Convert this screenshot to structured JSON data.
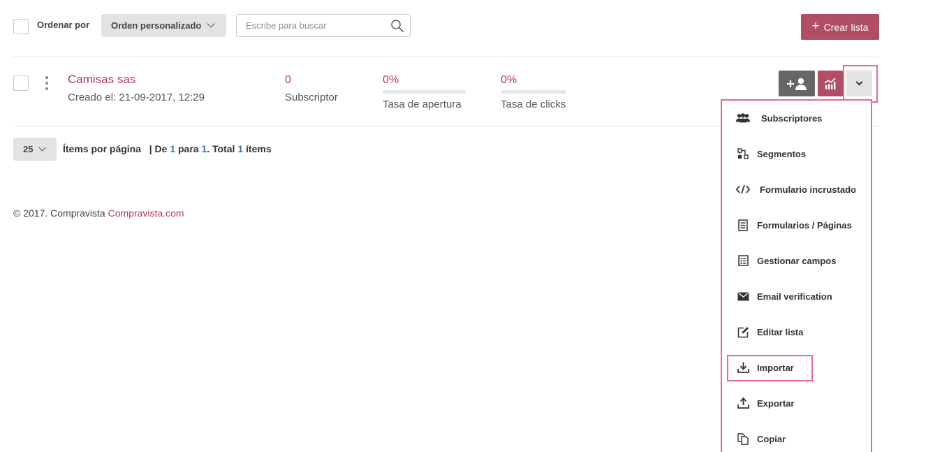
{
  "toolbar": {
    "sort_by_label": "Ordenar por",
    "sort_selected": "Orden personalizado",
    "search_placeholder": "Escribe para buscar",
    "create_label": "Crear lista",
    "create_plus": "+"
  },
  "list_row": {
    "name": "Camisas sas",
    "created": "Creado el: 21-09-2017, 12:29",
    "subscribers": {
      "value": "0",
      "label": "Subscriptor"
    },
    "open_rate": {
      "value": "0%",
      "label": "Tasa de apertura",
      "fraction": 0
    },
    "click_rate": {
      "value": "0%",
      "label": "Tasa de clicks",
      "fraction": 0
    },
    "actions": {
      "add_subscriber_icon": "add-person-icon",
      "stats_icon": "chart-icon",
      "more_icon": "chevron-down-icon"
    }
  },
  "pagination": {
    "per_page": "25",
    "per_page_label": "Ítems por página",
    "separator": "|",
    "from_label": "De",
    "from": "1",
    "to_label": "para",
    "to": "1",
    "total_label": ". Total",
    "total": "1",
    "items_label": "ítems"
  },
  "footer": {
    "copyright": "© 2017. Compravista",
    "link": "Compravista.com"
  },
  "dropdown": {
    "items": [
      {
        "label": "Subscriptores",
        "icon": "users-icon"
      },
      {
        "label": "Segmentos",
        "icon": "segments-icon"
      },
      {
        "label": "Formulario incrustado",
        "icon": "code-icon"
      },
      {
        "label": "Formularios / Páginas",
        "icon": "form-pages-icon"
      },
      {
        "label": "Gestionar campos",
        "icon": "fields-list-icon"
      },
      {
        "label": "Email verification",
        "icon": "envelope-icon"
      },
      {
        "label": "Editar lista",
        "icon": "edit-icon"
      },
      {
        "label": "Importar",
        "icon": "import-icon"
      },
      {
        "label": "Exportar",
        "icon": "export-icon"
      },
      {
        "label": "Copiar",
        "icon": "copy-icon"
      }
    ]
  },
  "colors": {
    "accent": "#b2395e",
    "button_primary": "#b04e66",
    "highlight": "#e8669a",
    "link_blue": "#3d6fb3"
  }
}
